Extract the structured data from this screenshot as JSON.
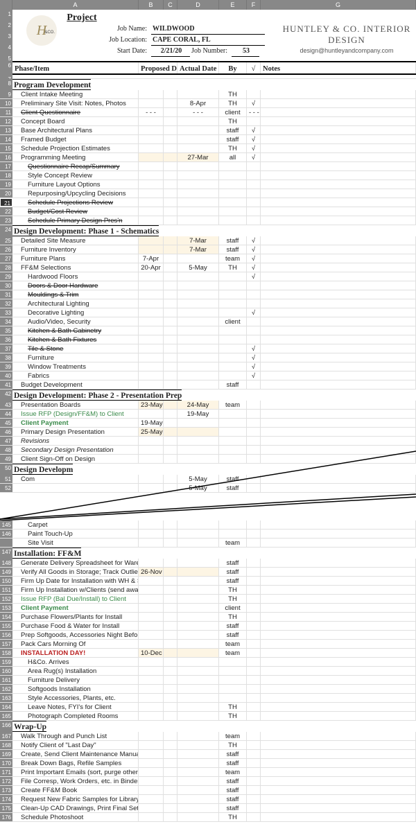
{
  "cols": [
    "A",
    "B",
    "C",
    "D",
    "E",
    "F",
    "G"
  ],
  "brand": {
    "name": "HUNTLEY & CO. INTERIOR DESIGN",
    "email": "design@huntleyandcompany.com"
  },
  "project": {
    "heading": "Project",
    "jobNameLabel": "Job Name:",
    "jobName": "WILDWOOD",
    "jobLocLabel": "Job Location:",
    "jobLoc": "CAPE CORAL, FL",
    "startDateLabel": "Start Date:",
    "startDate": "2/21/20",
    "jobNumLabel": "Job Number:",
    "jobNum": "53"
  },
  "hdr": {
    "phase": "Phase/Item",
    "proposed": "Proposed Date",
    "actual": "Actual Date",
    "by": "By",
    "chk": "√",
    "notes": "Notes"
  },
  "sec": {
    "prog": "Program Development",
    "dd1": "Design Development: Phase 1 - Schematics",
    "dd2": "Design Development: Phase 2 - Presentation Prep",
    "dd3": "Design Developm",
    "inst": "Installation: FF&M",
    "wrap": "Wrap-Up"
  },
  "r9": {
    "a": "Client Intake Meeting",
    "e": "TH"
  },
  "r10": {
    "a": "Preliminary Site Visit: Notes, Photos",
    "d": "8-Apr",
    "e": "TH",
    "f": "√"
  },
  "r11": {
    "a": "Client Questionnaire",
    "b": "- - -",
    "d": "- - -",
    "e": "client",
    "f": "- - -"
  },
  "r12": {
    "a": "Concept Board",
    "e": "TH"
  },
  "r13": {
    "a": "Base Architectural Plans",
    "e": "staff",
    "f": "√"
  },
  "r14": {
    "a": "Framed Budget",
    "e": "staff",
    "f": "√"
  },
  "r15": {
    "a": "Schedule Projection Estimates",
    "e": "TH",
    "f": "√"
  },
  "r16": {
    "a": "Programming Meeting",
    "d": "27-Mar",
    "e": "all",
    "f": "√"
  },
  "r17": {
    "a": "Questionnaire Recap/Summary"
  },
  "r18": {
    "a": "Style Concept Review"
  },
  "r19": {
    "a": "Furniture Layout Options"
  },
  "r20": {
    "a": "Repurposing/Upcycling Decisions"
  },
  "r21": {
    "a": "Schedule Projections Review"
  },
  "r22": {
    "a": "Budget/Cost Review"
  },
  "r23": {
    "a": "Schedule Primary Design Pres'n"
  },
  "r25": {
    "a": "Detailed Site Measure",
    "d": "7-Mar",
    "e": "staff",
    "f": "√"
  },
  "r26": {
    "a": "Furniture Inventory",
    "d": "7-Mar",
    "e": "staff",
    "f": "√"
  },
  "r27": {
    "a": "Furniture Plans",
    "b": "7-Apr",
    "e": "team",
    "f": "√"
  },
  "r28": {
    "a": "FF&M Selections",
    "b": "20-Apr",
    "d": "5-May",
    "e": "TH",
    "f": "√"
  },
  "r29": {
    "a": "Hardwood Floors",
    "f": "√"
  },
  "r30": {
    "a": "Doors & Door Hardware"
  },
  "r31": {
    "a": "Mouldings & Trim"
  },
  "r32": {
    "a": "Architectural Lighting"
  },
  "r33": {
    "a": "Decorative Lighting",
    "f": "√"
  },
  "r34": {
    "a": "Audio/Video, Security",
    "e": "client"
  },
  "r35": {
    "a": "Kitchen & Bath Cabinetry"
  },
  "r36": {
    "a": "Kitchen & Bath Fixtures"
  },
  "r37": {
    "a": "Tile & Stone",
    "f": "√"
  },
  "r38": {
    "a": "Furniture",
    "f": "√"
  },
  "r39": {
    "a": "Window Treatments",
    "f": "√"
  },
  "r40": {
    "a": "Fabrics",
    "f": "√"
  },
  "r41": {
    "a": "Budget Development",
    "e": "staff"
  },
  "r43": {
    "a": "Presentation Boards",
    "b": "23-May",
    "d": "24-May",
    "e": "team"
  },
  "r44": {
    "a": "Issue RFP (Design/FF&M) to Client",
    "d": "19-May"
  },
  "r45": {
    "a": "Client Payment",
    "b": "19-May"
  },
  "r46": {
    "a": "Primary Design Presentation",
    "b": "25-May"
  },
  "r47": {
    "a": "Revisions"
  },
  "r48": {
    "a": "Secondary Design Presentation"
  },
  "r49": {
    "a": "Client Sign-Off on Design"
  },
  "r51": {
    "a": "Com",
    "d": "5-May",
    "e": "staff"
  },
  "r52": {
    "d": "5-May",
    "e": "staff"
  },
  "r145": {
    "a": "Carpet"
  },
  "r146": {
    "a": "Paint Touch-Up"
  },
  "r147a": {
    "a": "Site Visit",
    "e": "team"
  },
  "r148": {
    "a": "Generate Delivery Spreadsheet for Warehouse",
    "e": "staff"
  },
  "r149": {
    "a": "Verify All Goods in Storage; Track Outliers",
    "b": "26-Nov",
    "e": "staff"
  },
  "r150": {
    "a": "Firm Up Date for Installation with WH & Subs",
    "e": "staff"
  },
  "r151": {
    "a": "Firm Up Installation w/Clients (send away!)",
    "e": "TH"
  },
  "r152": {
    "a": "Issue RFP (Bal Due/Install) to Client",
    "e": "TH"
  },
  "r153": {
    "a": "Client Payment",
    "e": "client"
  },
  "r154": {
    "a": "Purchase Flowers/Plants for Install",
    "e": "TH"
  },
  "r155": {
    "a": "Purchase Food & Water for Install",
    "e": "staff"
  },
  "r156": {
    "a": "Prep Softgoods, Accessories Night Before",
    "e": "staff"
  },
  "r157": {
    "a": "Pack Cars Morning Of",
    "e": "team"
  },
  "r158": {
    "a": "INSTALLATION DAY!",
    "b": "10-Dec",
    "e": "team"
  },
  "r159": {
    "a": "H&Co. Arrives"
  },
  "r160": {
    "a": "Area Rug(s) Installation"
  },
  "r161": {
    "a": "Furniture Delivery"
  },
  "r162": {
    "a": "Softgoods Installation"
  },
  "r163": {
    "a": "Style Accessories, Plants, etc."
  },
  "r164": {
    "a": "Leave Notes, FYI's for Client",
    "e": "TH"
  },
  "r165": {
    "a": "Photograph Completed Rooms",
    "e": "TH"
  },
  "r167": {
    "a": "Walk Through and Punch List",
    "e": "team"
  },
  "r168": {
    "a": "Notify Client of \"Last Day\"",
    "e": "TH"
  },
  "r169": {
    "a": "Create, Send Client Maintenance Manual",
    "e": "staff"
  },
  "r170": {
    "a": "Break Down Bags, Refile Samples",
    "e": "staff"
  },
  "r171": {
    "a": "Print Important Emails (sort, purge others)",
    "e": "team"
  },
  "r172": {
    "a": "File Corresp, Work Orders, etc. in Binder",
    "e": "staff"
  },
  "r173": {
    "a": "Create FF&M Book",
    "e": "staff"
  },
  "r174": {
    "a": "Request New Fabric Samples for Library",
    "e": "staff"
  },
  "r175": {
    "a": "Clean-Up CAD Drawings, Print Final Set",
    "e": "staff"
  },
  "r176": {
    "a": "Schedule Photoshoot",
    "e": "TH"
  }
}
